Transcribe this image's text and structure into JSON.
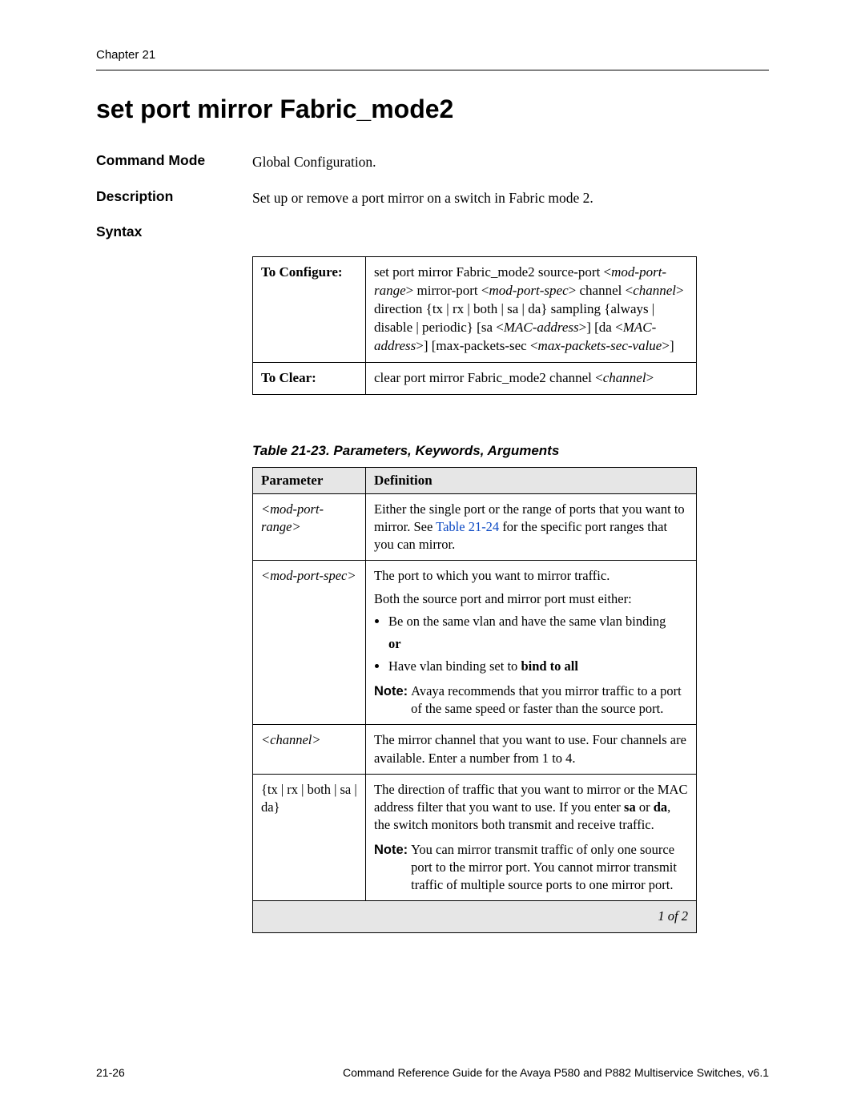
{
  "header": {
    "chapter": "Chapter 21"
  },
  "title": "set port mirror Fabric_mode2",
  "fields": {
    "command_mode": {
      "label": "Command Mode",
      "value": "Global Configuration."
    },
    "description": {
      "label": "Description",
      "value": "Set up or remove a port mirror on a switch in Fabric mode 2."
    },
    "syntax": {
      "label": "Syntax"
    }
  },
  "syntax_table": {
    "configure": {
      "label": "To Configure:",
      "parts": {
        "p1": "set port mirror Fabric_mode2 source-port <",
        "i1": "mod-port-range",
        "p2": "> mirror-port <",
        "i2": "mod-port-spec",
        "p3": "> channel <",
        "i3": "channel",
        "p4": "> direction {tx | rx | both | sa | da} sampling {always | disable | periodic} [sa <",
        "i4": "MAC-address",
        "p5": ">] [da <",
        "i5": "MAC-address",
        "p6": ">] [max-packets-sec <",
        "i6": "max-packets-sec-value",
        "p7": ">]"
      }
    },
    "clear": {
      "label": "To Clear:",
      "parts": {
        "p1": "clear port mirror Fabric_mode2 channel <",
        "i1": "channel",
        "p2": ">"
      }
    }
  },
  "param_table": {
    "caption": "Table 21-23. Parameters, Keywords, Arguments",
    "headers": {
      "param": "Parameter",
      "def": "Definition"
    },
    "rows": {
      "r1": {
        "param": "<mod-port-range>",
        "def_pre": "Either the single port or the range of ports that you want to mirror. See ",
        "def_link": "Table 21-24",
        "def_post": " for the specific port ranges that you can mirror."
      },
      "r2": {
        "param": "<mod-port-spec>",
        "line1": "The port to which you want to mirror traffic.",
        "line2": "Both the source port and mirror port must either:",
        "bullet1": "Be on the same vlan and have the same vlan binding",
        "or": "or",
        "bullet2_pre": "Have vlan binding set to ",
        "bullet2_bold": "bind to all",
        "note_label": "Note:",
        "note_text": " Avaya recommends that you mirror traffic to a port of the same speed or faster than the source port."
      },
      "r3": {
        "param": "<channel>",
        "def": "The mirror channel that you want to use. Four channels are available. Enter a number from 1 to 4."
      },
      "r4": {
        "param": "{tx | rx | both | sa | da}",
        "def_pre": "The direction of traffic that you want to mirror or the MAC address filter that you want to use. If you enter ",
        "b1": "sa",
        "def_mid": " or ",
        "b2": "da",
        "def_post": ", the switch monitors both transmit and receive traffic.",
        "note_label": "Note:",
        "note_text": " You can mirror transmit traffic of only one source port to the mirror port. You cannot mirror transmit traffic of multiple source ports to one mirror port."
      }
    },
    "footer": "1 of 2"
  },
  "footer": {
    "left": "21-26",
    "right": "Command Reference Guide for the Avaya P580 and P882 Multiservice Switches, v6.1"
  }
}
